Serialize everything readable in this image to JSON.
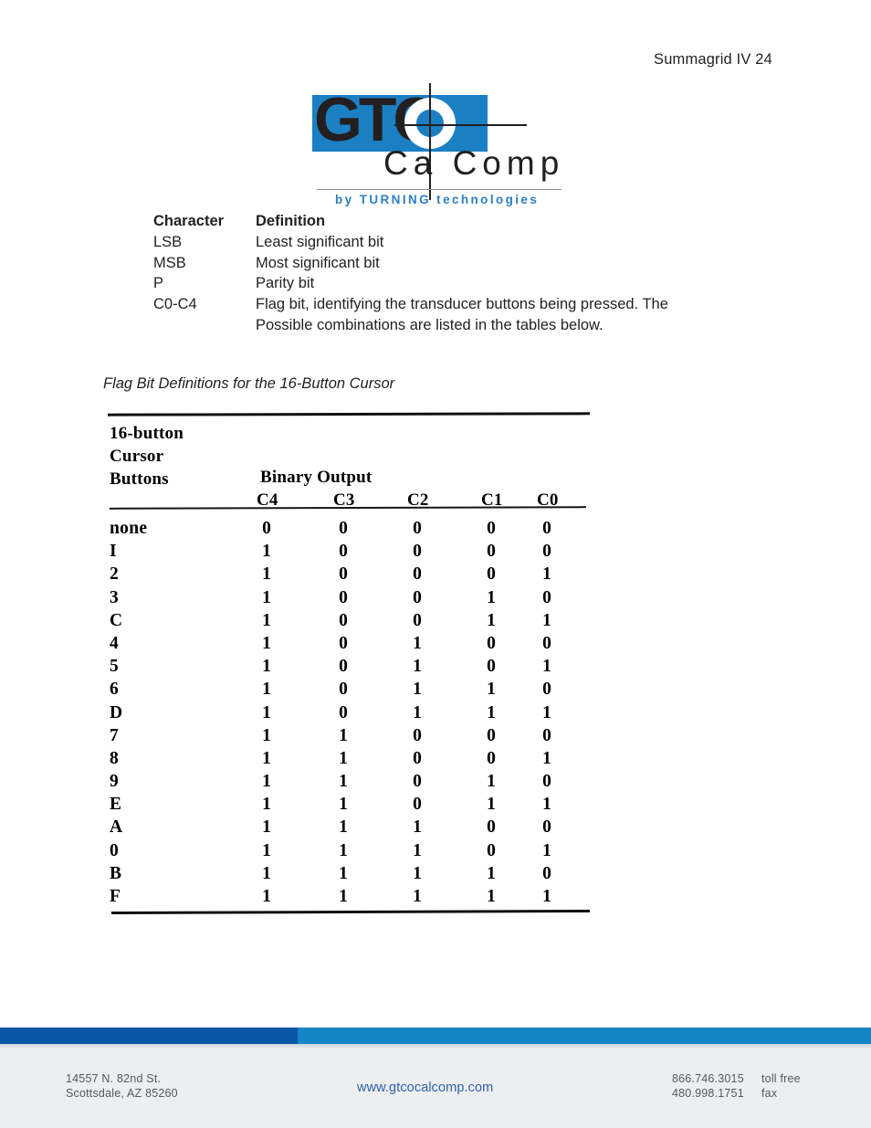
{
  "header": {
    "running_title": "Summagrid IV 24"
  },
  "logo": {
    "wordmark": "GTC",
    "brand": "Ca Comp",
    "tagline_by": "by",
    "tagline_brand": "TURNING",
    "tagline_rest": "technologies",
    "blue": "#1B7FC4",
    "tagline_color": "#2f7fc0"
  },
  "definitions": {
    "head_term": "Character",
    "head_desc": "Definition",
    "rows": [
      {
        "term": "LSB",
        "desc": "Least significant bit"
      },
      {
        "term": "MSB",
        "desc": "Most significant bit"
      },
      {
        "term": "P",
        "desc": "Parity bit"
      },
      {
        "term": "C0-C4",
        "desc": "Flag bit, identifying the transducer buttons being pressed.  The"
      }
    ],
    "continuation": "Possible combinations are listed in the tables below."
  },
  "figure": {
    "caption": "Flag Bit Definitions for the 16-Button Cursor"
  },
  "table": {
    "head_line1": "16-button",
    "head_line2": "Cursor",
    "head_line3": "Buttons",
    "binary_output_label": "Binary Output",
    "columns": [
      "C4",
      "C3",
      "C2",
      "C1",
      "C0"
    ],
    "rows": [
      {
        "button": "none",
        "bits": [
          "0",
          "0",
          "0",
          "0",
          "0"
        ]
      },
      {
        "button": "I",
        "bits": [
          "1",
          "0",
          "0",
          "0",
          "0"
        ]
      },
      {
        "button": "2",
        "bits": [
          "1",
          "0",
          "0",
          "0",
          "1"
        ]
      },
      {
        "button": "3",
        "bits": [
          "1",
          "0",
          "0",
          "1",
          "0"
        ]
      },
      {
        "button": "C",
        "bits": [
          "1",
          "0",
          "0",
          "1",
          "1"
        ]
      },
      {
        "button": "4",
        "bits": [
          "1",
          "0",
          "1",
          "0",
          "0"
        ]
      },
      {
        "button": "5",
        "bits": [
          "1",
          "0",
          "1",
          "0",
          "1"
        ]
      },
      {
        "button": "6",
        "bits": [
          "1",
          "0",
          "1",
          "1",
          "0"
        ]
      },
      {
        "button": "D",
        "bits": [
          "1",
          "0",
          "1",
          "1",
          "1"
        ]
      },
      {
        "button": "7",
        "bits": [
          "1",
          "1",
          "0",
          "0",
          "0"
        ]
      },
      {
        "button": "8",
        "bits": [
          "1",
          "1",
          "0",
          "0",
          "1"
        ]
      },
      {
        "button": "9",
        "bits": [
          "1",
          "1",
          "0",
          "1",
          "0"
        ]
      },
      {
        "button": "E",
        "bits": [
          "1",
          "1",
          "0",
          "1",
          "1"
        ]
      },
      {
        "button": "A",
        "bits": [
          "1",
          "1",
          "1",
          "0",
          "0"
        ]
      },
      {
        "button": "0",
        "bits": [
          "1",
          "1",
          "1",
          "0",
          "1"
        ]
      },
      {
        "button": "B",
        "bits": [
          "1",
          "1",
          "1",
          "1",
          "0"
        ]
      },
      {
        "button": "F",
        "bits": [
          "1",
          "1",
          "1",
          "1",
          "1"
        ]
      }
    ]
  },
  "footer": {
    "address_line1": "14557 N. 82nd St.",
    "address_line2": "Scottsdale, AZ 85260",
    "website": "www.gtcocalcomp.com",
    "phone_tollfree_number": "866.746.3015",
    "phone_tollfree_label": "toll free",
    "phone_fax_number": "480.998.1751",
    "phone_fax_label": "fax",
    "bar_dark": "#0A56A6",
    "bar_light": "#1685C7"
  }
}
